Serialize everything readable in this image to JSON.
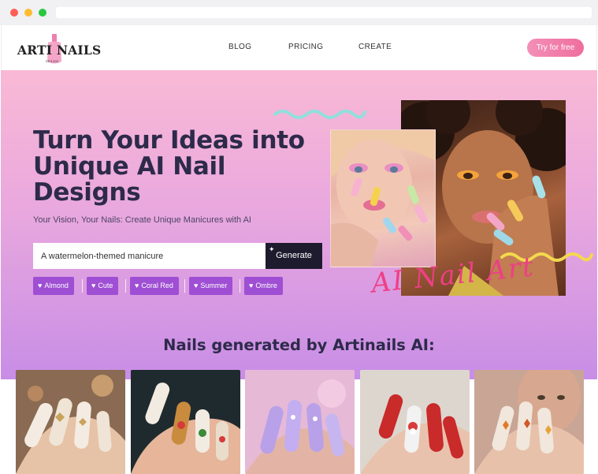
{
  "header": {
    "logo_text": "ARTI NAILS",
    "logo_subtext": "DESIGN",
    "nav": [
      "BLOG",
      "PRICING",
      "CREATE"
    ],
    "cta_label": "Try for free"
  },
  "hero": {
    "title": "Turn Your Ideas into Unique AI Nail Designs",
    "subtitle": "Your Vision, Your Nails: Create Unique Manicures with AI",
    "prompt_value": "A watermelon-themed manicure",
    "generate_label": "Generate",
    "chips": [
      "Almond",
      "Cute",
      "Coral Red",
      "Summer",
      "Ombre"
    ],
    "script_text": "AI Nail Art"
  },
  "gallery": {
    "title": "Nails generated by Artinails AI:",
    "images": [
      "butterfly-nails",
      "floral-nails",
      "lavender-nails",
      "santa-nails",
      "autumn-leaf-nails"
    ]
  },
  "colors": {
    "accent_pink": "#ef6e9d",
    "chip_purple": "#9f4fd3",
    "heading_dark": "#2d2a4a",
    "generate_dark": "#1f1b2e"
  },
  "icons": [
    "heart-icon",
    "sparkle-icon"
  ]
}
